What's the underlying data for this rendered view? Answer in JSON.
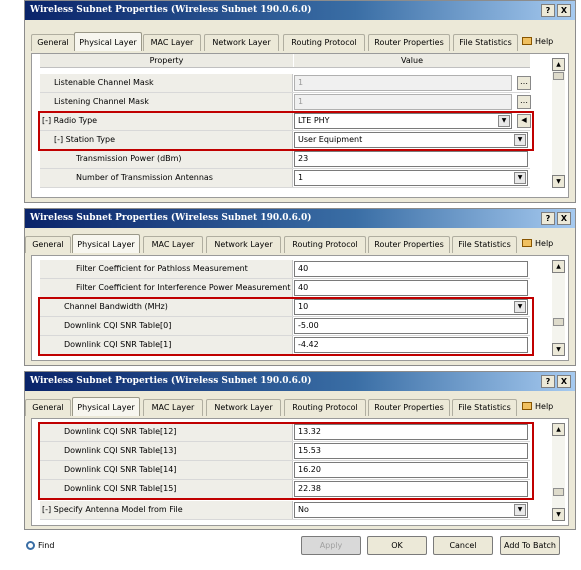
{
  "window": {
    "title": "Wireless Subnet Properties (Wireless Subnet 190.0.6.0)",
    "help_btn": "?",
    "close_btn": "X"
  },
  "tabs": [
    "General",
    "Physical Layer",
    "MAC Layer",
    "Network Layer",
    "Routing Protocol",
    "Router Properties",
    "File Statistics"
  ],
  "active_tab": "Physical Layer",
  "help_label": "Help",
  "columns": {
    "property": "Property",
    "value": "Value"
  },
  "panel1": {
    "rows": [
      {
        "name": "Listenable Channel Mask",
        "value": "1"
      },
      {
        "name": "Listening Channel Mask",
        "value": "1"
      },
      {
        "name": "[-] Radio Type",
        "value": "LTE PHY"
      },
      {
        "name": "[-] Station Type",
        "value": "User Equipment"
      },
      {
        "name": "Transmission Power (dBm)",
        "value": "23"
      },
      {
        "name": "Number of Transmission Antennas",
        "value": "1"
      }
    ]
  },
  "panel2": {
    "rows": [
      {
        "name": "Filter Coefficient for Pathloss Measurement",
        "value": "40"
      },
      {
        "name": "Filter Coefficient for Interference Power Measurement",
        "value": "40"
      },
      {
        "name": "Channel Bandwidth (MHz)",
        "value": "10"
      },
      {
        "name": "Downlink CQI SNR Table[0]",
        "value": "-5.00"
      },
      {
        "name": "Downlink CQI SNR Table[1]",
        "value": "-4.42"
      }
    ]
  },
  "panel3": {
    "rows": [
      {
        "name": "Downlink CQI SNR Table[12]",
        "value": "13.32"
      },
      {
        "name": "Downlink CQI SNR Table[13]",
        "value": "15.53"
      },
      {
        "name": "Downlink CQI SNR Table[14]",
        "value": "16.20"
      },
      {
        "name": "Downlink CQI SNR Table[15]",
        "value": "22.38"
      },
      {
        "name": "[-] Specify Antenna Model from File",
        "value": "No"
      }
    ]
  },
  "buttons": {
    "find": "Find",
    "apply": "Apply",
    "ok": "OK",
    "cancel": "Cancel",
    "add_to_batch": "Add To Batch"
  },
  "colors": {
    "highlight": "#c00000",
    "titlebar": "#0a246a"
  }
}
